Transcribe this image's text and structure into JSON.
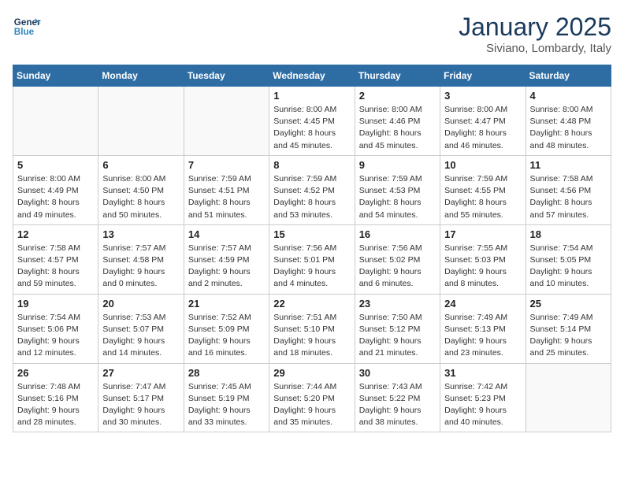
{
  "logo": {
    "line1": "General",
    "line2": "Blue"
  },
  "title": "January 2025",
  "subtitle": "Siviano, Lombardy, Italy",
  "weekdays": [
    "Sunday",
    "Monday",
    "Tuesday",
    "Wednesday",
    "Thursday",
    "Friday",
    "Saturday"
  ],
  "weeks": [
    [
      {
        "day": "",
        "info": ""
      },
      {
        "day": "",
        "info": ""
      },
      {
        "day": "",
        "info": ""
      },
      {
        "day": "1",
        "info": "Sunrise: 8:00 AM\nSunset: 4:45 PM\nDaylight: 8 hours\nand 45 minutes."
      },
      {
        "day": "2",
        "info": "Sunrise: 8:00 AM\nSunset: 4:46 PM\nDaylight: 8 hours\nand 45 minutes."
      },
      {
        "day": "3",
        "info": "Sunrise: 8:00 AM\nSunset: 4:47 PM\nDaylight: 8 hours\nand 46 minutes."
      },
      {
        "day": "4",
        "info": "Sunrise: 8:00 AM\nSunset: 4:48 PM\nDaylight: 8 hours\nand 48 minutes."
      }
    ],
    [
      {
        "day": "5",
        "info": "Sunrise: 8:00 AM\nSunset: 4:49 PM\nDaylight: 8 hours\nand 49 minutes."
      },
      {
        "day": "6",
        "info": "Sunrise: 8:00 AM\nSunset: 4:50 PM\nDaylight: 8 hours\nand 50 minutes."
      },
      {
        "day": "7",
        "info": "Sunrise: 7:59 AM\nSunset: 4:51 PM\nDaylight: 8 hours\nand 51 minutes."
      },
      {
        "day": "8",
        "info": "Sunrise: 7:59 AM\nSunset: 4:52 PM\nDaylight: 8 hours\nand 53 minutes."
      },
      {
        "day": "9",
        "info": "Sunrise: 7:59 AM\nSunset: 4:53 PM\nDaylight: 8 hours\nand 54 minutes."
      },
      {
        "day": "10",
        "info": "Sunrise: 7:59 AM\nSunset: 4:55 PM\nDaylight: 8 hours\nand 55 minutes."
      },
      {
        "day": "11",
        "info": "Sunrise: 7:58 AM\nSunset: 4:56 PM\nDaylight: 8 hours\nand 57 minutes."
      }
    ],
    [
      {
        "day": "12",
        "info": "Sunrise: 7:58 AM\nSunset: 4:57 PM\nDaylight: 8 hours\nand 59 minutes."
      },
      {
        "day": "13",
        "info": "Sunrise: 7:57 AM\nSunset: 4:58 PM\nDaylight: 9 hours\nand 0 minutes."
      },
      {
        "day": "14",
        "info": "Sunrise: 7:57 AM\nSunset: 4:59 PM\nDaylight: 9 hours\nand 2 minutes."
      },
      {
        "day": "15",
        "info": "Sunrise: 7:56 AM\nSunset: 5:01 PM\nDaylight: 9 hours\nand 4 minutes."
      },
      {
        "day": "16",
        "info": "Sunrise: 7:56 AM\nSunset: 5:02 PM\nDaylight: 9 hours\nand 6 minutes."
      },
      {
        "day": "17",
        "info": "Sunrise: 7:55 AM\nSunset: 5:03 PM\nDaylight: 9 hours\nand 8 minutes."
      },
      {
        "day": "18",
        "info": "Sunrise: 7:54 AM\nSunset: 5:05 PM\nDaylight: 9 hours\nand 10 minutes."
      }
    ],
    [
      {
        "day": "19",
        "info": "Sunrise: 7:54 AM\nSunset: 5:06 PM\nDaylight: 9 hours\nand 12 minutes."
      },
      {
        "day": "20",
        "info": "Sunrise: 7:53 AM\nSunset: 5:07 PM\nDaylight: 9 hours\nand 14 minutes."
      },
      {
        "day": "21",
        "info": "Sunrise: 7:52 AM\nSunset: 5:09 PM\nDaylight: 9 hours\nand 16 minutes."
      },
      {
        "day": "22",
        "info": "Sunrise: 7:51 AM\nSunset: 5:10 PM\nDaylight: 9 hours\nand 18 minutes."
      },
      {
        "day": "23",
        "info": "Sunrise: 7:50 AM\nSunset: 5:12 PM\nDaylight: 9 hours\nand 21 minutes."
      },
      {
        "day": "24",
        "info": "Sunrise: 7:49 AM\nSunset: 5:13 PM\nDaylight: 9 hours\nand 23 minutes."
      },
      {
        "day": "25",
        "info": "Sunrise: 7:49 AM\nSunset: 5:14 PM\nDaylight: 9 hours\nand 25 minutes."
      }
    ],
    [
      {
        "day": "26",
        "info": "Sunrise: 7:48 AM\nSunset: 5:16 PM\nDaylight: 9 hours\nand 28 minutes."
      },
      {
        "day": "27",
        "info": "Sunrise: 7:47 AM\nSunset: 5:17 PM\nDaylight: 9 hours\nand 30 minutes."
      },
      {
        "day": "28",
        "info": "Sunrise: 7:45 AM\nSunset: 5:19 PM\nDaylight: 9 hours\nand 33 minutes."
      },
      {
        "day": "29",
        "info": "Sunrise: 7:44 AM\nSunset: 5:20 PM\nDaylight: 9 hours\nand 35 minutes."
      },
      {
        "day": "30",
        "info": "Sunrise: 7:43 AM\nSunset: 5:22 PM\nDaylight: 9 hours\nand 38 minutes."
      },
      {
        "day": "31",
        "info": "Sunrise: 7:42 AM\nSunset: 5:23 PM\nDaylight: 9 hours\nand 40 minutes."
      },
      {
        "day": "",
        "info": ""
      }
    ]
  ]
}
